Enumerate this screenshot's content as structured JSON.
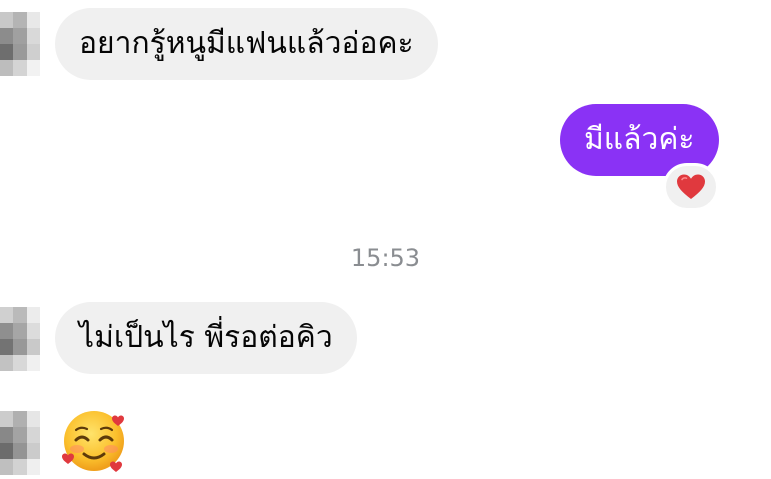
{
  "thread": {
    "messages": [
      {
        "sender": "them",
        "text": "อยากรู้หนูมีแฟนแล้วอ่อคะ"
      },
      {
        "sender": "me",
        "text": "มีแล้วค่ะ",
        "reaction": "heart"
      },
      {
        "sender": "them",
        "text": "ไม่เป็นไร พี่รอต่อคิว"
      },
      {
        "sender": "them",
        "sticker": "smiling-face-with-hearts"
      }
    ],
    "timestamp": "15:53"
  },
  "colors": {
    "incoming_bubble": "#f0f0f0",
    "outgoing_bubble": "#8a32f5",
    "heart": "#e0393e"
  }
}
